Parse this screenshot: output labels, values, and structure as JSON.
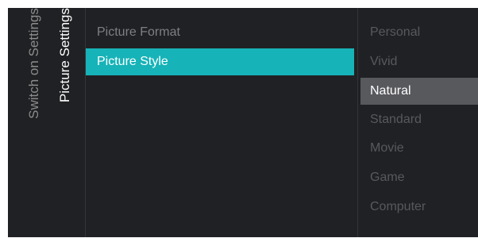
{
  "breadcrumb": {
    "parent": "Switch on Settings",
    "current": "Picture Settings"
  },
  "menu": {
    "items": [
      {
        "label": "Picture Format",
        "state": "normal"
      },
      {
        "label": "Picture Style",
        "state": "highlighted"
      }
    ]
  },
  "options": {
    "items": [
      {
        "label": "Personal"
      },
      {
        "label": "Vivid"
      },
      {
        "label": "Natural",
        "selected": true
      },
      {
        "label": "Standard"
      },
      {
        "label": "Movie"
      },
      {
        "label": "Game"
      },
      {
        "label": "Computer"
      }
    ]
  },
  "colors": {
    "background": "#202124",
    "highlight": "#16b3b8",
    "selected_option": "#58595d",
    "dim_text": "#58595c",
    "menu_text": "#7e7f82"
  }
}
